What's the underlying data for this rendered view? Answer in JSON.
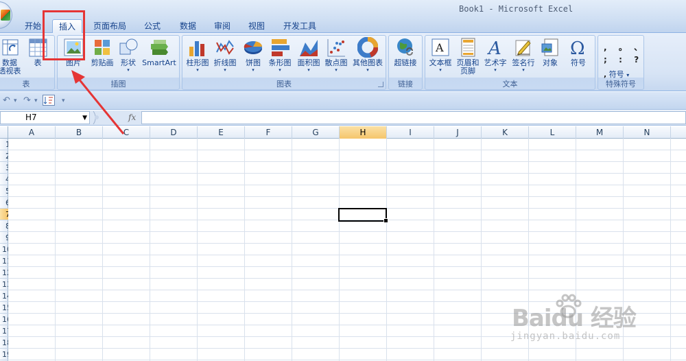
{
  "window": {
    "title": "Book1 - Microsoft Excel"
  },
  "tabs": [
    {
      "label": "开始"
    },
    {
      "label": "插入"
    },
    {
      "label": "页面布局"
    },
    {
      "label": "公式"
    },
    {
      "label": "数据"
    },
    {
      "label": "审阅"
    },
    {
      "label": "视图"
    },
    {
      "label": "开发工具"
    }
  ],
  "active_tab": "插入",
  "ribbon": {
    "groups": {
      "tables": {
        "label": "表",
        "items": [
          {
            "label1": "数据",
            "label2": "透视表"
          },
          {
            "label": "表"
          }
        ]
      },
      "illustrations": {
        "label": "插图",
        "items": [
          {
            "label": "图片"
          },
          {
            "label": "剪贴画"
          },
          {
            "label": "形状"
          },
          {
            "label": "SmartArt"
          }
        ]
      },
      "charts": {
        "label": "图表",
        "items": [
          {
            "label": "柱形图"
          },
          {
            "label": "折线图"
          },
          {
            "label": "饼图"
          },
          {
            "label": "条形图"
          },
          {
            "label": "面积图"
          },
          {
            "label": "散点图"
          },
          {
            "label": "其他图表"
          }
        ]
      },
      "links": {
        "label": "链接",
        "items": [
          {
            "label": "超链接"
          }
        ]
      },
      "text": {
        "label": "文本",
        "items": [
          {
            "label": "文本框"
          },
          {
            "label1": "页眉和",
            "label2": "页脚"
          },
          {
            "label": "艺术字"
          },
          {
            "label": "签名行"
          },
          {
            "label": "对象"
          },
          {
            "label": "符号"
          }
        ]
      },
      "symbols": {
        "label": "特殊符号",
        "row1": ",  。 、",
        "row2": ";  :  ?",
        "button": "符号"
      }
    }
  },
  "formula_bar": {
    "name_box": "H7",
    "fx": "fx",
    "formula": ""
  },
  "grid": {
    "columns": [
      "A",
      "B",
      "C",
      "D",
      "E",
      "F",
      "G",
      "H",
      "I",
      "J",
      "K",
      "L",
      "M",
      "N"
    ],
    "selected_column": "H",
    "rows": [
      "1",
      "2",
      "3",
      "4",
      "5",
      "6",
      "7",
      "8",
      "9",
      "10",
      "11",
      "12",
      "13",
      "14",
      "15",
      "16",
      "17",
      "18",
      "19"
    ],
    "selected_row": "7"
  },
  "watermark": {
    "main": "Baidu 经验",
    "sub": "jingyan.baidu.com"
  },
  "annotation_color": "#e53535"
}
